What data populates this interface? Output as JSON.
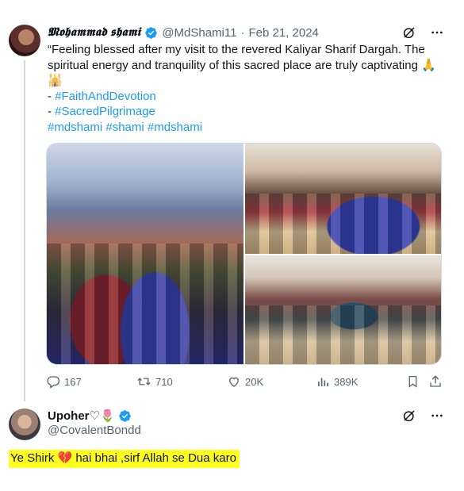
{
  "tweet": {
    "author_name": "𝕸𝖔𝖍𝖆𝖒𝖒𝖆𝖉 𝖘𝖍𝖆𝖒𝖎",
    "handle": "@MdShami11",
    "separator": "·",
    "date": "Feb 21, 2024",
    "text_line1": "“Feeling blessed after my visit to the revered Kaliyar Sharif Dargah. The",
    "text_line2": "spiritual energy and tranquility of this sacred place are truly captivating 🙏",
    "text_line3": "🕌",
    "hashtag_prefix": "- ",
    "hashtag1": "#FaithAndDevotion",
    "hashtag2": "#SacredPilgrimage",
    "hashtags_line": "#mdshami #shami #mdshami",
    "stats": {
      "replies": "167",
      "reposts": "710",
      "likes": "20K",
      "views": "389K"
    }
  },
  "reply": {
    "author_name": "Upoher♡🌷",
    "handle": "@CovalentBondd",
    "text": "Ye Shirk 💔 hai bhai ,sirf Allah se Dua karo"
  },
  "colors": {
    "link": "#1d9bf0",
    "muted": "#536471",
    "highlight": "#ffff22",
    "verified": "#1d9bf0"
  },
  "icons": [
    "grok-icon",
    "more-icon",
    "verified-icon",
    "reply-icon",
    "repost-icon",
    "like-icon",
    "views-icon",
    "bookmark-icon",
    "share-icon"
  ]
}
